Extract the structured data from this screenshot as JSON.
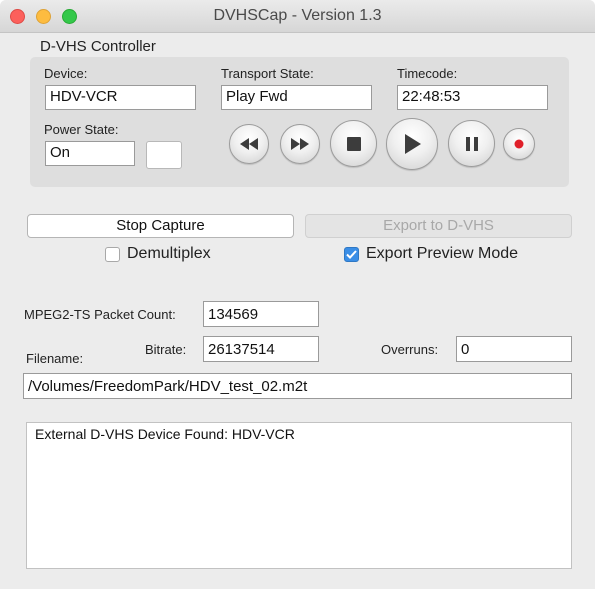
{
  "window": {
    "title": "DVHSCap - Version 1.3"
  },
  "controller": {
    "group_title": "D-VHS Controller",
    "device_label": "Device:",
    "device_value": "HDV-VCR",
    "transport_label": "Transport State:",
    "transport_value": "Play Fwd",
    "timecode_label": "Timecode:",
    "timecode_value": "22:48:53",
    "power_label": "Power State:",
    "power_value": "On",
    "transport_buttons": [
      "rewind-icon",
      "fast-forward-icon",
      "stop-icon",
      "play-icon",
      "pause-icon",
      "record-icon"
    ]
  },
  "capture": {
    "stop_capture_label": "Stop Capture",
    "export_label": "Export to D-VHS",
    "export_enabled": false,
    "demultiplex_label": "Demultiplex",
    "demultiplex_checked": false,
    "export_preview_label": "Export Preview Mode",
    "export_preview_checked": true
  },
  "stats": {
    "packet_count_label": "MPEG2-TS Packet Count:",
    "packet_count_value": "134569",
    "bitrate_label": "Bitrate:",
    "bitrate_value": "26137514",
    "overruns_label": "Overruns:",
    "overruns_value": "0",
    "filename_label": "Filename:",
    "filename_value": "/Volumes/FreedomPark/HDV_test_02.m2t"
  },
  "log": {
    "lines": [
      "External D-VHS Device Found: HDV-VCR"
    ]
  },
  "colors": {
    "accent": "#3a8ee6",
    "record": "#e0202a",
    "close": "#fc605c",
    "minimize": "#fdbc40",
    "maximize": "#34c84a"
  }
}
